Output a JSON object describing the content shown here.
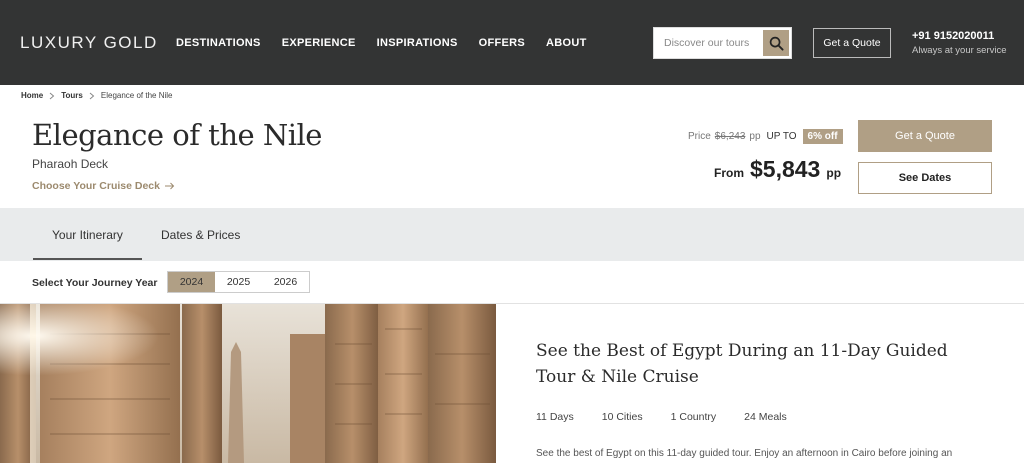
{
  "header": {
    "logo": "LUXURY GOLD",
    "nav": [
      "DESTINATIONS",
      "EXPERIENCE",
      "INSPIRATIONS",
      "OFFERS",
      "ABOUT"
    ],
    "search_placeholder": "Discover our tours",
    "quote_label": "Get a Quote",
    "phone": "+91 9152020011",
    "service_text": "Always at your service"
  },
  "breadcrumb": {
    "home": "Home",
    "tours": "Tours",
    "current": "Elegance of the Nile"
  },
  "tour": {
    "title": "Elegance of the Nile",
    "subtitle": "Pharaoh Deck",
    "deck_link": "Choose Your Cruise Deck"
  },
  "pricing": {
    "price_label": "Price",
    "old_price": "$6,243",
    "pp_small": "pp",
    "upto_label": "UP TO",
    "discount": "6% off",
    "from_label": "From",
    "amount": "$5,843",
    "pp": "pp",
    "quote_button": "Get a Quote",
    "dates_button": "See Dates"
  },
  "tabs": [
    "Your Itinerary",
    "Dates & Prices"
  ],
  "journey": {
    "label": "Select Your Journey Year",
    "years": [
      "2024",
      "2025",
      "2026"
    ],
    "selected": "2024"
  },
  "content": {
    "headline": "See the Best of Egypt During an 11-Day Guided Tour & Nile Cruise",
    "stats": [
      "11 Days",
      "10 Cities",
      "1 Country",
      "24 Meals"
    ],
    "description": "See the best of Egypt on this 11-day guided tour. Enjoy an afternoon in Cairo before joining an"
  },
  "colors": {
    "header_bg": "#333434",
    "accent": "#b09f85",
    "tab_bg": "#e9ebec"
  },
  "icons": {
    "search": "search-icon",
    "chevron": "chevron-right-icon",
    "arrow": "arrow-right-icon"
  }
}
